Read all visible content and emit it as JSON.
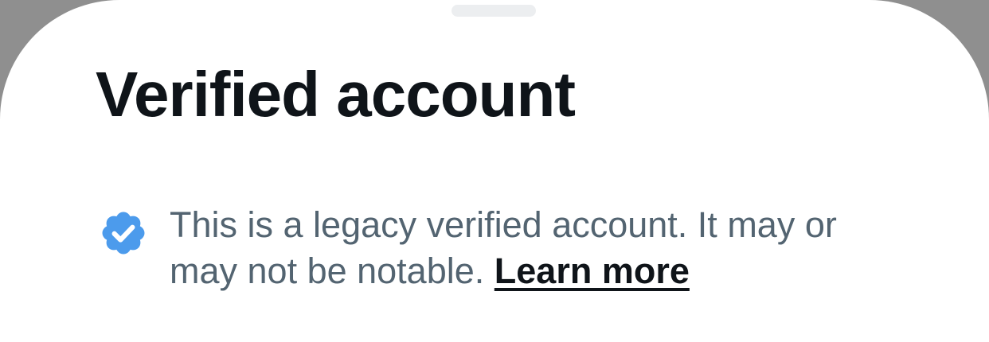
{
  "sheet": {
    "title": "Verified account",
    "description_line1": "This is a legacy verified account. It may or",
    "description_line2": "may not be notable.",
    "learn_more": "Learn more"
  },
  "icons": {
    "badge": "verified-badge-icon"
  },
  "colors": {
    "title": "#0f1419",
    "body_text": "#536471",
    "badge": "#4c9bec",
    "grabber": "#eceef0",
    "backdrop": "#8f8f8f"
  }
}
